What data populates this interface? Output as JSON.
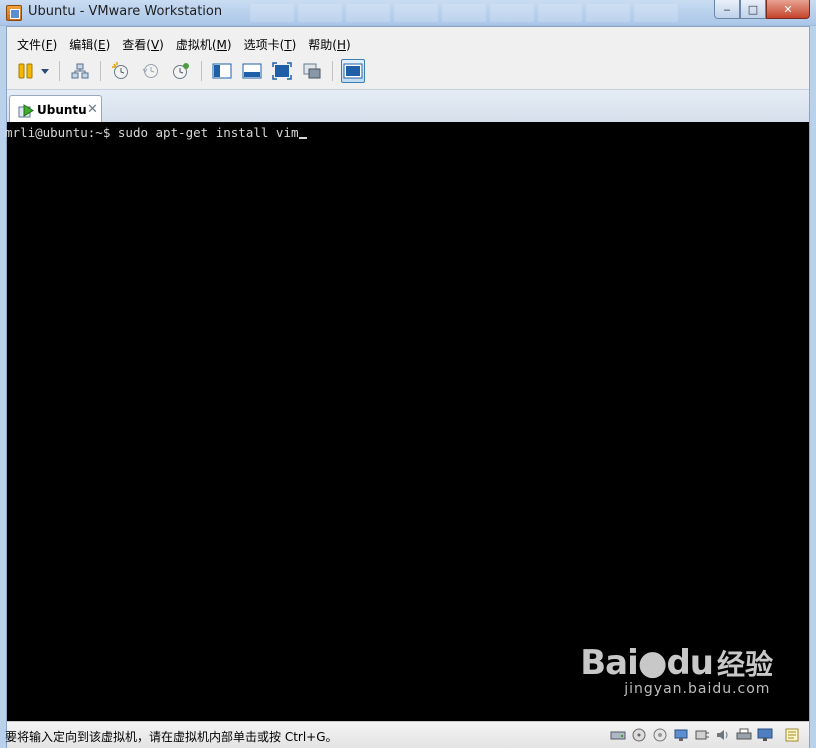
{
  "window": {
    "title": "Ubuntu - VMware Workstation",
    "min_glyph": "‒",
    "max_glyph": "□",
    "close_glyph": "✕"
  },
  "menu": [
    {
      "text": "文件(",
      "key": "F",
      "end": ")"
    },
    {
      "text": "编辑(",
      "key": "E",
      "end": ")"
    },
    {
      "text": "查看(",
      "key": "V",
      "end": ")"
    },
    {
      "text": "虚拟机(",
      "key": "M",
      "end": ")"
    },
    {
      "text": "选项卡(",
      "key": "T",
      "end": ")"
    },
    {
      "text": "帮助(",
      "key": "H",
      "end": ")"
    }
  ],
  "toolbar": {
    "icons": [
      "power-pause-icon",
      "dropdown-arrow-icon",
      "network-icon",
      "snapshot-take-icon",
      "snapshot-revert-icon",
      "snapshot-manager-icon",
      "show-console-icon",
      "fit-guest-icon",
      "full-screen-icon",
      "unity-icon",
      "console-view-icon"
    ]
  },
  "tab": {
    "label": "Ubuntu",
    "close_glyph": "✕"
  },
  "console": {
    "prompt": "mrli@ubuntu:~$ ",
    "command": "sudo apt-get install vim"
  },
  "watermark": {
    "logo_a": "Bai",
    "logo_b": "du",
    "cn": "经验",
    "url": "jingyan.baidu.com"
  },
  "status": {
    "text": "要将输入定向到该虚拟机，请在虚拟机内部单击或按 Ctrl+G。",
    "icons": [
      "hard-disk-icon",
      "cd-dvd-icon",
      "floppy-icon",
      "network-adapter-icon",
      "usb-icon",
      "sound-icon",
      "printer-icon",
      "display-icon",
      "message-log-icon"
    ]
  },
  "colors": {
    "titlebar": "#aac6e8",
    "console_bg": "#000000",
    "console_fg": "#d8d8d8",
    "close_button": "#c4442c"
  }
}
